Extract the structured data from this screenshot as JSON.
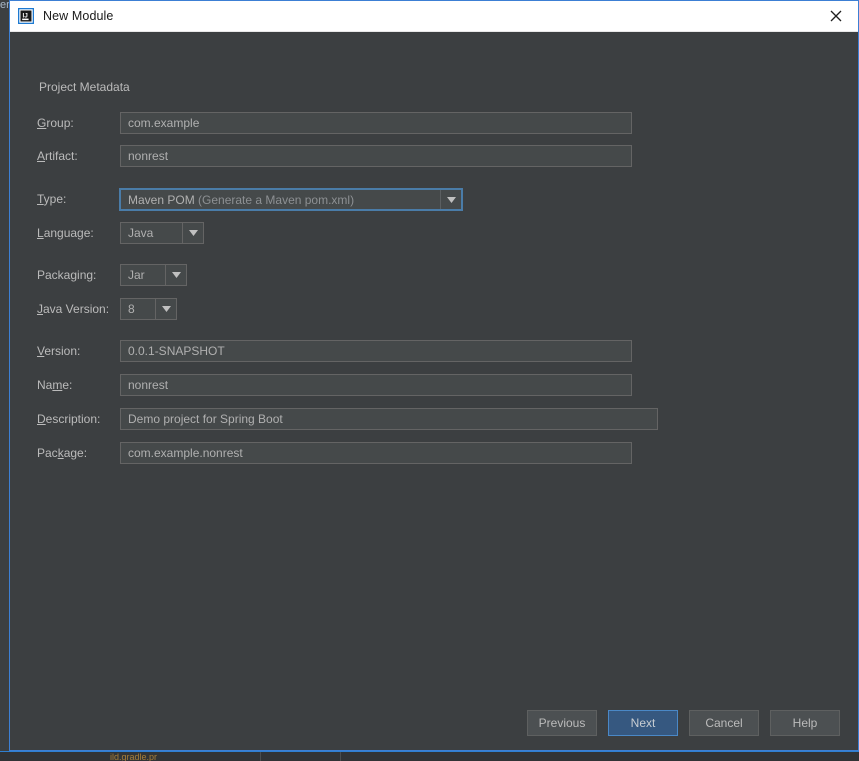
{
  "window": {
    "title": "New Module",
    "app_icon": "intellij-idea-icon",
    "close_icon": "close-icon",
    "accent_border_color": "#3c7fd4",
    "titlebar_bg": "#ffffff",
    "panel_bg": "#3c3f41"
  },
  "background": {
    "top_left_fragment": "er",
    "bottom_fragment": "ild.gradle.pr"
  },
  "form": {
    "section_title": "Project Metadata",
    "fields": [
      {
        "id": "group",
        "label_before": "",
        "label_mnemonic": "G",
        "label_after": "roup:",
        "control": "text",
        "value": "com.example"
      },
      {
        "id": "artifact",
        "label_before": "",
        "label_mnemonic": "A",
        "label_after": "rtifact:",
        "control": "text",
        "value": "nonrest"
      },
      {
        "id": "type",
        "label_before": "",
        "label_mnemonic": "T",
        "label_after": "ype:",
        "control": "combo",
        "value": "Maven POM",
        "value_detail": "(Generate a Maven pom.xml)",
        "focused": true,
        "arrow_icon": "chevron-down-icon"
      },
      {
        "id": "language",
        "label_before": "",
        "label_mnemonic": "L",
        "label_after": "anguage:",
        "control": "combo",
        "value": "Java",
        "arrow_icon": "chevron-down-icon"
      },
      {
        "id": "packaging",
        "label_before": "Packa",
        "label_mnemonic": "g",
        "label_after": "ing:",
        "control": "combo",
        "value": "Jar",
        "arrow_icon": "chevron-down-icon"
      },
      {
        "id": "java-version",
        "label_before": "",
        "label_mnemonic": "J",
        "label_after": "ava Version:",
        "control": "combo",
        "value": "8",
        "arrow_icon": "chevron-down-icon"
      },
      {
        "id": "version",
        "label_before": "",
        "label_mnemonic": "V",
        "label_after": "ersion:",
        "control": "text",
        "value": "0.0.1-SNAPSHOT"
      },
      {
        "id": "name",
        "label_before": "Na",
        "label_mnemonic": "m",
        "label_after": "e:",
        "control": "text",
        "value": "nonrest"
      },
      {
        "id": "description",
        "label_before": "",
        "label_mnemonic": "D",
        "label_after": "escription:",
        "control": "text",
        "value": "Demo project for Spring Boot"
      },
      {
        "id": "package",
        "label_before": "Pac",
        "label_mnemonic": "k",
        "label_after": "age:",
        "control": "text",
        "value": "com.example.nonrest"
      }
    ]
  },
  "footer": {
    "buttons": [
      {
        "id": "previous",
        "label": "Previous",
        "primary": false
      },
      {
        "id": "next",
        "label": "Next",
        "primary": true
      },
      {
        "id": "cancel",
        "label": "Cancel",
        "primary": false
      },
      {
        "id": "help",
        "label": "Help",
        "primary": false
      }
    ]
  }
}
